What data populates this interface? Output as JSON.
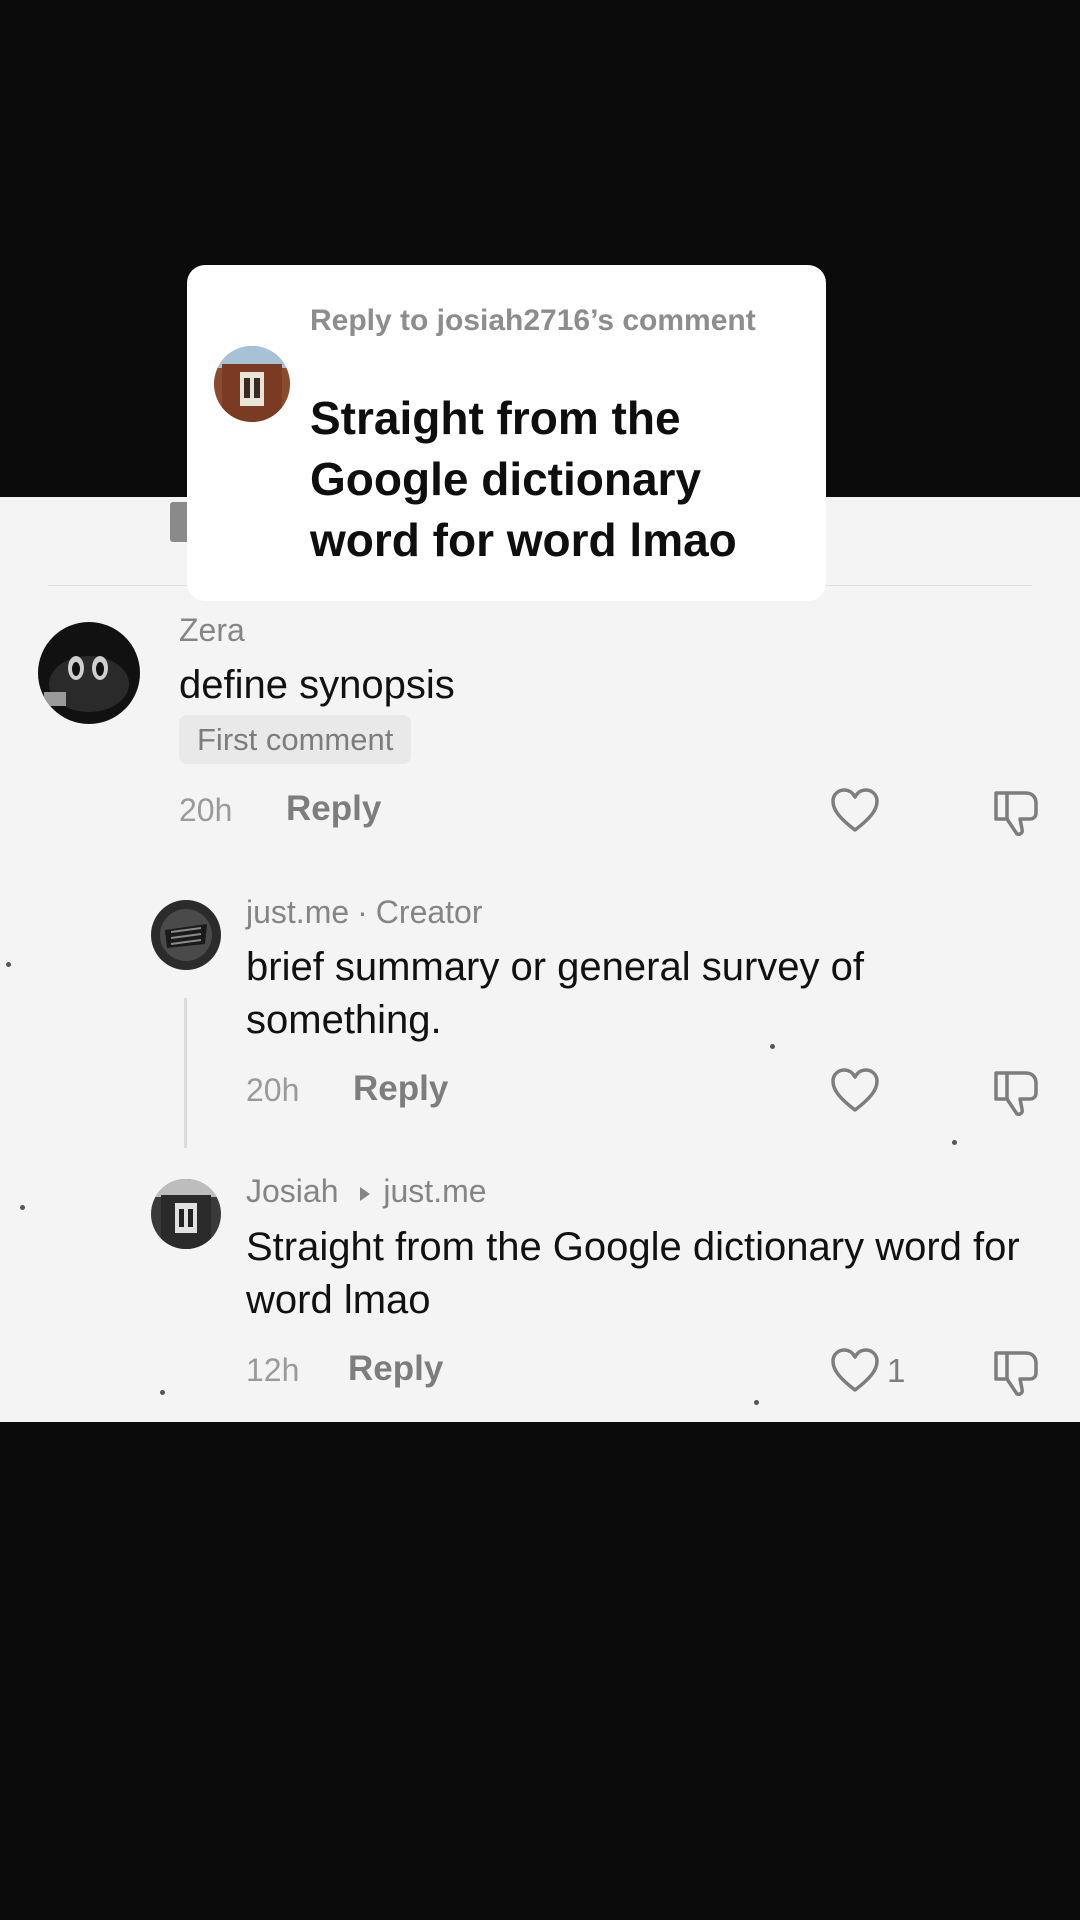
{
  "reply_card": {
    "reply_to": "Reply to josiah2716’s comment",
    "text": "Straight from the Google dictionary word for word lmao"
  },
  "comments": [
    {
      "username": "Zera",
      "text": "define synopsis",
      "badge": "First comment",
      "time": "20h",
      "reply_label": "Reply"
    },
    {
      "username": "just.me",
      "separator": "·",
      "role": "Creator",
      "text": "brief summary or general survey of something.",
      "time": "20h",
      "reply_label": "Reply"
    },
    {
      "username": "Josiah",
      "reply_target": "just.me",
      "text": "Straight from the Google dictionary word for word lmao",
      "time": "12h",
      "reply_label": "Reply",
      "like_count": "1"
    }
  ],
  "icons": [
    "heart-icon",
    "dislike-icon",
    "reply-arrow-icon",
    "avatar"
  ],
  "colors": {
    "panel": "#f4f4f4",
    "background": "#0b0b0b",
    "muted": "#858585"
  }
}
